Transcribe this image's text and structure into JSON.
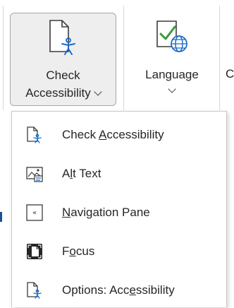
{
  "ribbon": {
    "check_accessibility": {
      "line1": "Check",
      "line2": "Accessibility",
      "icon": "accessibility-document-icon"
    },
    "language": {
      "label": "Language",
      "icon": "language-icon"
    },
    "next_button_partial": "C"
  },
  "menu": {
    "items": [
      {
        "label_pre": "Check ",
        "label_ul": "A",
        "label_post": "ccessibility",
        "icon": "accessibility-document-icon"
      },
      {
        "label_pre": "A",
        "label_ul": "l",
        "label_post": "t Text",
        "icon": "alt-text-icon"
      },
      {
        "label_pre": "",
        "label_ul": "N",
        "label_post": "avigation Pane",
        "icon": "navigation-pane-icon"
      },
      {
        "label_pre": "F",
        "label_ul": "o",
        "label_post": "cus",
        "icon": "focus-icon"
      },
      {
        "label_pre": "Options: Acc",
        "label_ul": "e",
        "label_post": "ssibility",
        "icon": "accessibility-options-icon"
      }
    ]
  },
  "colors": {
    "accent_blue": "#1e6bc6",
    "check_green": "#3a9a3a",
    "hover_bg": "#eeeeee"
  }
}
